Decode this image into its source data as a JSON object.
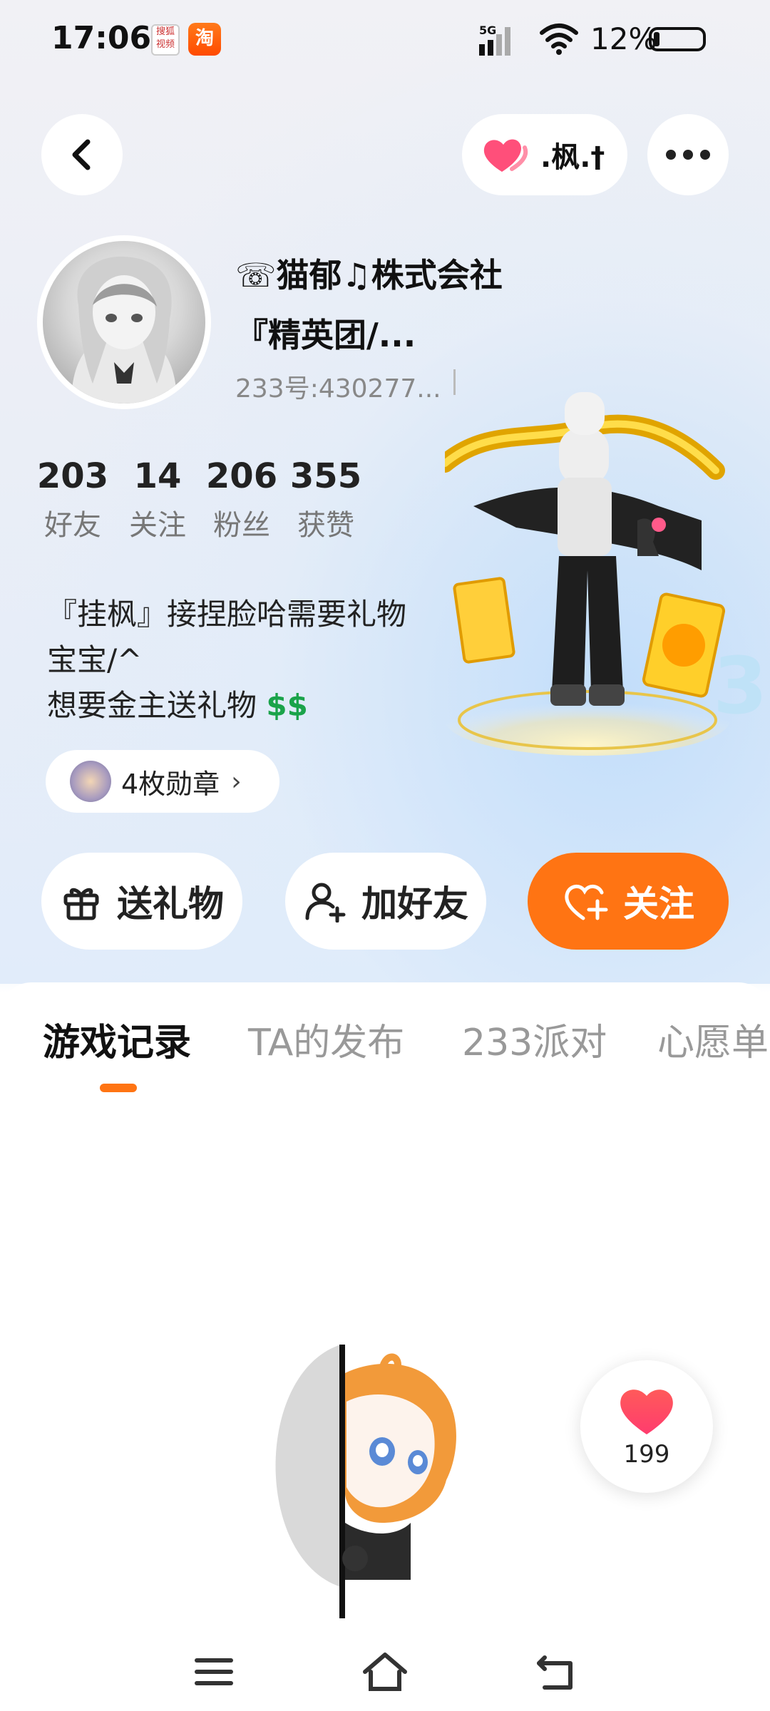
{
  "status_bar": {
    "time": "17:06",
    "app_icon_1": "搜狐视频",
    "app_icon_2": "淘",
    "network": "5G",
    "battery_percent": "12%"
  },
  "header": {
    "back_icon": "chevron-left-icon",
    "companion_chip": {
      "icon": "heart-icon",
      "label": ".枫.†",
      "heart_color": "#ff4f7a"
    },
    "more_icon": "more-dots-icon"
  },
  "profile": {
    "name_line1": "☏猫郁♫株式会社",
    "name_line2": "『精英团/...",
    "id_text": "233号:430277...",
    "stats": [
      {
        "value": "203",
        "label": "好友"
      },
      {
        "value": "14",
        "label": "关注"
      },
      {
        "value": "206",
        "label": "粉丝"
      },
      {
        "value": "355",
        "label": "获赞"
      }
    ],
    "bio_line1": "『挂枫』接捏脸哈需要礼物",
    "bio_line2": "宝宝/^",
    "bio_line3": "想要金主送礼物",
    "bio_suffix": "$$",
    "medals_label": "4枚勋章"
  },
  "actions": {
    "gift_label": "送礼物",
    "add_friend_label": "加好友",
    "follow_label": "关注",
    "follow_color": "#ff7413"
  },
  "tabs": [
    {
      "label": "游戏记录",
      "active": true
    },
    {
      "label": "TA的发布",
      "active": false
    },
    {
      "label": "233派对",
      "active": false
    },
    {
      "label": "心愿单",
      "active": false
    }
  ],
  "like_fab": {
    "count": "199"
  },
  "nav": {
    "menu_icon": "menu-icon",
    "home_icon": "home-icon",
    "back_icon": "back-icon"
  }
}
